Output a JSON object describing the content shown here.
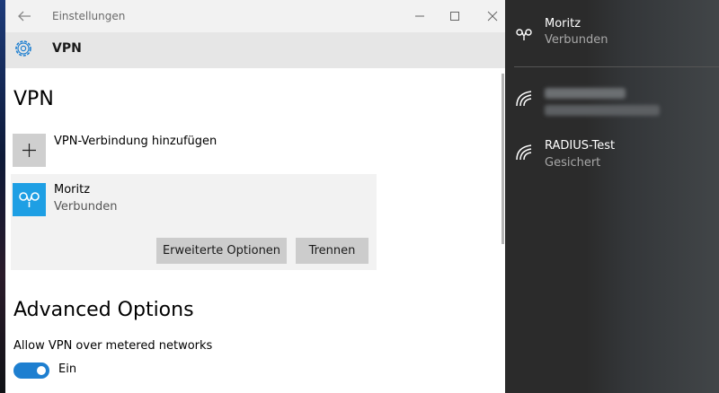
{
  "window": {
    "title": "Einstellungen",
    "header_title": "VPN"
  },
  "main": {
    "page_title": "VPN",
    "add_connection_label": "VPN-Verbindung hinzufügen",
    "connection": {
      "name": "Moritz",
      "status": "Verbunden",
      "advanced_button": "Erweiterte Optionen",
      "disconnect_button": "Trennen"
    },
    "advanced": {
      "title": "Advanced Options",
      "metered_label": "Allow VPN over metered networks",
      "toggle_state": "Ein"
    }
  },
  "flyout": {
    "vpn": {
      "name": "Moritz",
      "status": "Verbunden"
    },
    "networks": [
      {
        "name": "",
        "status": "",
        "redacted": true
      },
      {
        "name": "RADIUS-Test",
        "status": "Gesichert"
      }
    ]
  },
  "colors": {
    "accent": "#1e9fe4",
    "toggle_on": "#1e7fd0",
    "flyout_bg": "#2b2b2b"
  },
  "icons": {
    "back": "back-arrow-icon",
    "gear": "gear-icon",
    "vpn": "vpn-link-icon",
    "wifi": "wifi-icon",
    "add": "plus-icon"
  }
}
